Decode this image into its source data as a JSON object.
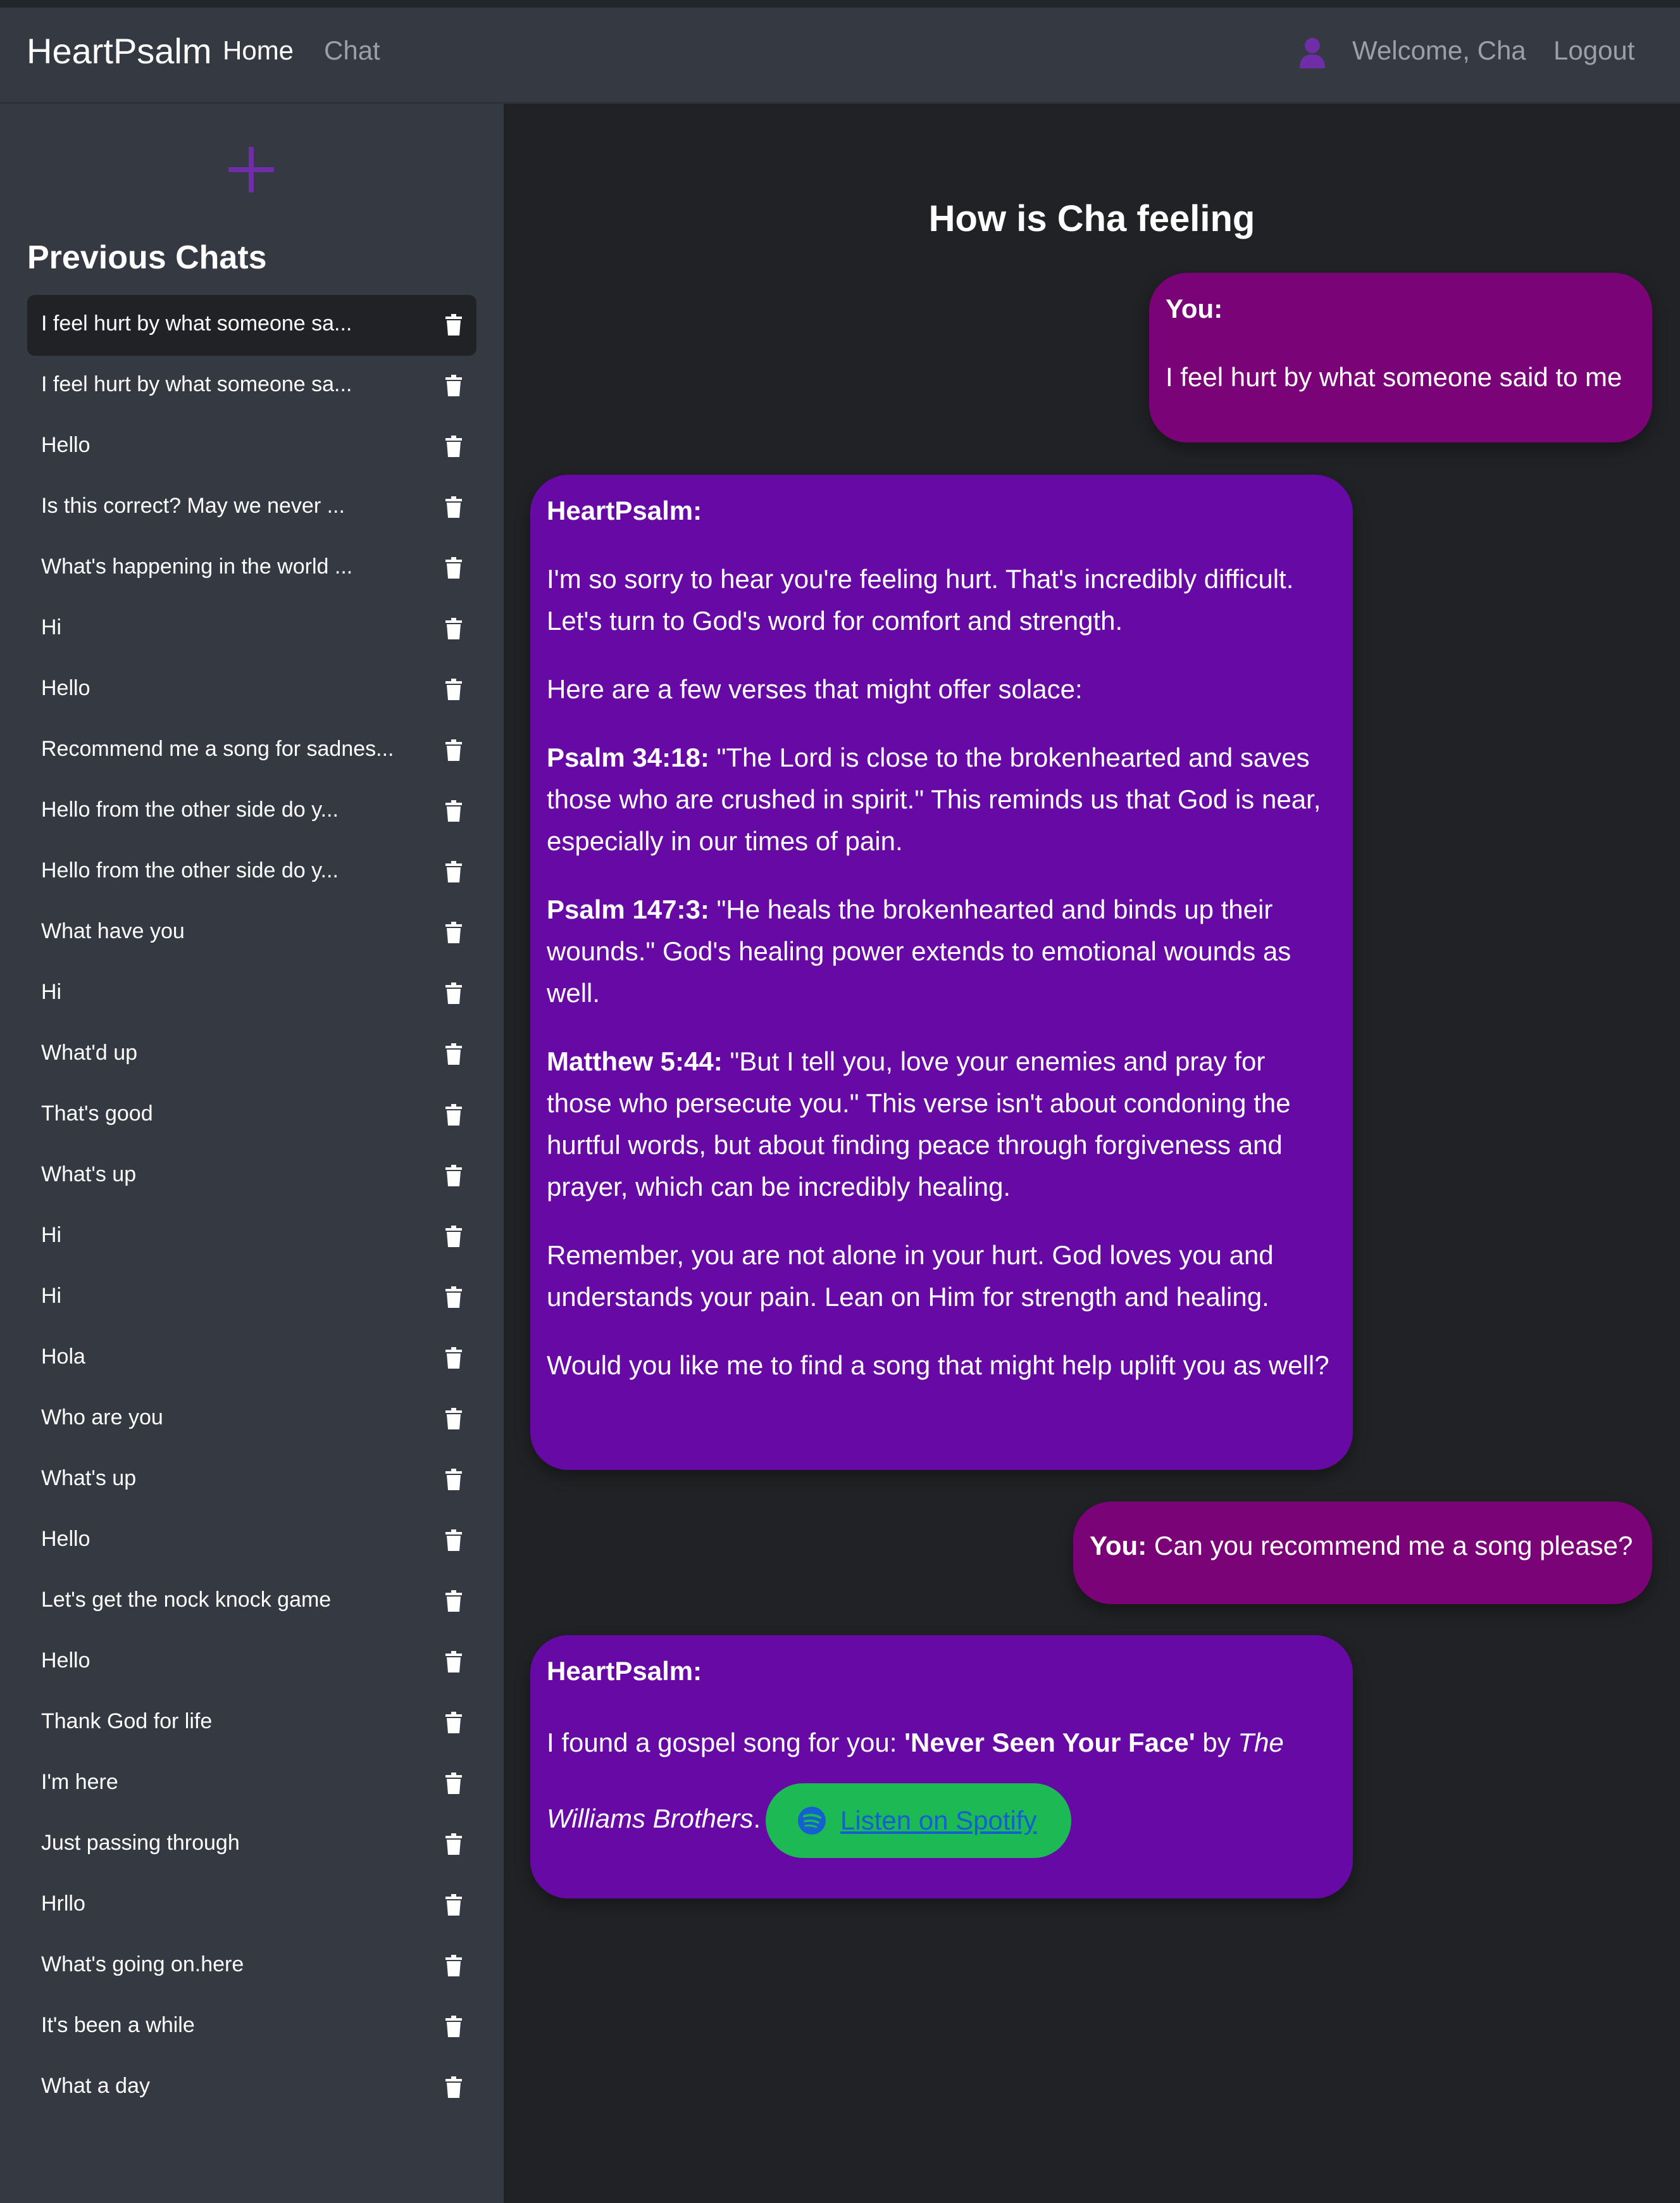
{
  "colors": {
    "accent": "#6f2da8",
    "user_bubble": "#7a0378",
    "bot_bubble": "#6709a5",
    "spotify_green": "#1db954",
    "link_blue": "#1560d0"
  },
  "navbar": {
    "brand": "HeartPsalm",
    "links": [
      "Home",
      "Chat"
    ],
    "user_icon": "user-icon",
    "welcome": "Welcome, Cha",
    "logout": "Logout"
  },
  "sidebar": {
    "new_chat_icon": "plus-icon",
    "title": "Previous Chats",
    "delete_icon": "trash-icon",
    "chats": [
      "I feel hurt by what someone sa...",
      "I feel hurt by what someone sa...",
      "Hello",
      "Is this correct? May we never ...",
      "What's happening in the world ...",
      "Hi",
      "Hello",
      "Recommend me a song for sadnes...",
      "Hello from the other side do y...",
      "Hello from the other side do y...",
      "What have you",
      "Hi",
      "What'd up",
      "That's good",
      "What's up",
      "Hi",
      "Hi",
      "Hola",
      "Who are you",
      "What's up",
      "Hello",
      "Let's get the nock knock game",
      "Hello",
      "Thank God for life",
      "I'm here",
      "Just passing through",
      "Hrllo",
      "What's going on.here",
      "It's been a while",
      "What a day"
    ]
  },
  "main": {
    "title": "How is Cha feeling",
    "messages": {
      "m1": {
        "sender": "You:",
        "text": "I feel hurt by what someone said to me"
      },
      "m2": {
        "sender": "HeartPsalm:",
        "p1": "I'm so sorry to hear you're feeling hurt. That's incredibly difficult. Let's turn to God's word for comfort and strength.",
        "p2": "Here are a few verses that might offer solace:",
        "v1_ref": "Psalm 34:18:",
        "v1_text": " \"The Lord is close to the brokenhearted and saves those who are crushed in spirit.\" This reminds us that God is near, especially in our times of pain.",
        "v2_ref": "Psalm 147:3:",
        "v2_text": " \"He heals the brokenhearted and binds up their wounds.\" God's healing power extends to emotional wounds as well.",
        "v3_ref": "Matthew 5:44:",
        "v3_text": " \"But I tell you, love your enemies and pray for those who persecute you.\" This verse isn't about condoning the hurtful words, but about finding peace through forgiveness and prayer, which can be incredibly healing.",
        "p3": "Remember, you are not alone in your hurt. God loves you and understands your pain. Lean on Him for strength and healing.",
        "p4": "Would you like me to find a song that might help uplift you as well?"
      },
      "m3": {
        "sender": "You:",
        "text": " Can you recommend me a song please?"
      },
      "m4": {
        "sender": "HeartPsalm:",
        "intro": "I found a gospel song for you: ",
        "song": "'Never Seen Your Face'",
        "by": " by ",
        "artist": "The Williams Brothers",
        "period": ".",
        "spotify_icon": "spotify-icon",
        "spotify_label": "Listen on Spotify"
      }
    }
  }
}
